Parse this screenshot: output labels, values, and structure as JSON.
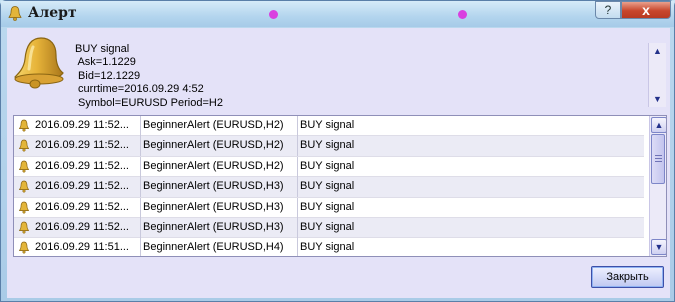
{
  "window": {
    "title": "Алерт",
    "help_label": "?",
    "close_label": "x"
  },
  "message": {
    "icon": "bell-icon",
    "lines": [
      "BUY signal",
      " Ask=1.1229",
      " Bid=12.1229",
      " currtime=2016.09.29 4:52",
      " Symbol=EURUSD Period=H2"
    ]
  },
  "alerts": [
    {
      "time": "2016.09.29 11:52...",
      "source": "BeginnerAlert (EURUSD,H2)",
      "message": "BUY signal"
    },
    {
      "time": "2016.09.29 11:52...",
      "source": "BeginnerAlert (EURUSD,H2)",
      "message": "BUY signal"
    },
    {
      "time": "2016.09.29 11:52...",
      "source": "BeginnerAlert (EURUSD,H2)",
      "message": "BUY signal"
    },
    {
      "time": "2016.09.29 11:52...",
      "source": "BeginnerAlert (EURUSD,H3)",
      "message": "BUY signal"
    },
    {
      "time": "2016.09.29 11:52...",
      "source": "BeginnerAlert (EURUSD,H3)",
      "message": "BUY signal"
    },
    {
      "time": "2016.09.29 11:52...",
      "source": "BeginnerAlert (EURUSD,H3)",
      "message": "BUY signal"
    },
    {
      "time": "2016.09.29 11:51...",
      "source": "BeginnerAlert (EURUSD,H4)",
      "message": "BUY signal"
    }
  ],
  "buttons": {
    "close_label": "Закрыть"
  },
  "colors": {
    "accent": "#3d4fa8",
    "close_red": "#c8462c",
    "client_bg": "#e4e2f8"
  }
}
